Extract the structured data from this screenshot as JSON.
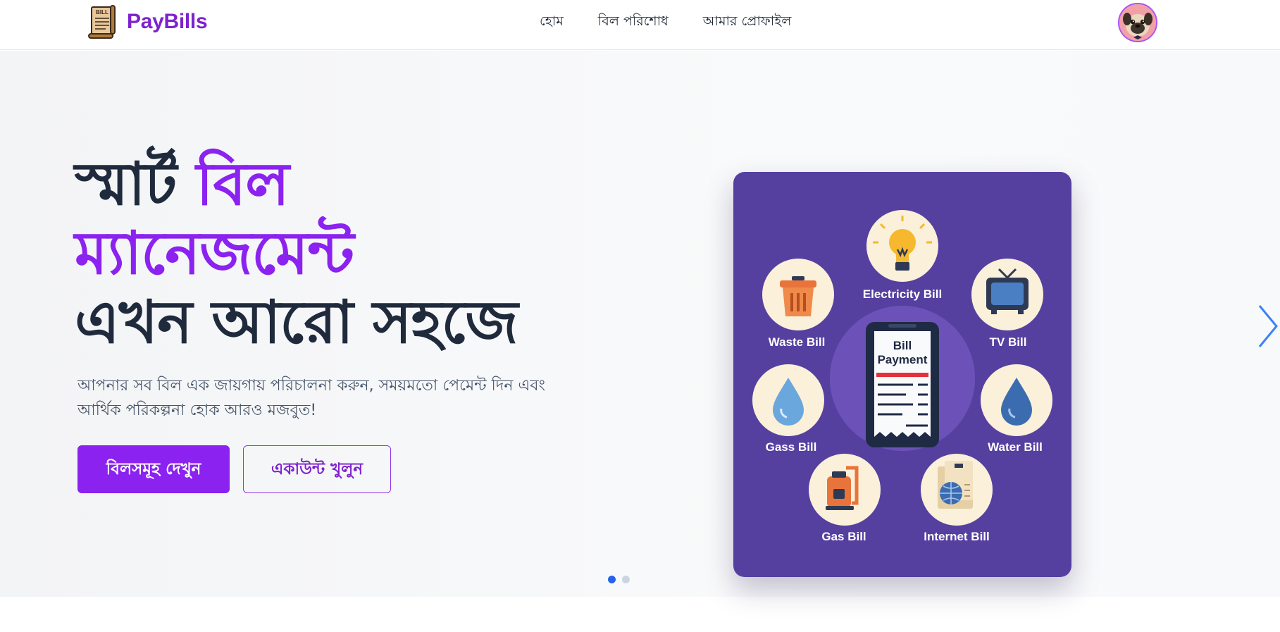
{
  "brand": {
    "name": "PayBills",
    "logo_icon": "bill-scroll-icon",
    "logo_text": "BILL"
  },
  "nav": {
    "links": [
      "হোম",
      "বিল পরিশোধ",
      "আমার প্রোফাইল"
    ]
  },
  "user": {
    "avatar_icon": "pug-avatar-icon"
  },
  "hero": {
    "headline_line1_a": "স্মার্ট",
    "headline_line1_b": "বিল",
    "headline_line2": "ম্যানেজমেন্ট",
    "headline_line3": "এখন আরো সহজে",
    "subtitle_line1": "আপনার সব বিল এক জায়গায় পরিচালনা করুন, সময়মতো পেমেন্ট দিন এবং",
    "subtitle_line2": "আর্থিক পরিকল্পনা হোক আরও মজবুত!",
    "primary_button": "বিলসমূহ দেখুন",
    "secondary_button": "একাউন্ট খুলুন"
  },
  "illustration": {
    "center_title_1": "Bill",
    "center_title_2": "Payment",
    "items": [
      {
        "label": "Electricity Bill",
        "icon": "lightbulb-icon"
      },
      {
        "label": "Waste Bill",
        "icon": "trash-bin-icon"
      },
      {
        "label": "TV Bill",
        "icon": "tv-icon"
      },
      {
        "label": "Gass  Bill",
        "icon": "water-drop-icon"
      },
      {
        "label": "Water Bill",
        "icon": "water-drop-icon"
      },
      {
        "label": "Gas Bill",
        "icon": "gas-cylinder-icon"
      },
      {
        "label": "Internet Bill",
        "icon": "globe-document-icon"
      }
    ]
  },
  "carousel": {
    "slide_count": 2,
    "active_slide": 1,
    "next_icon": "chevron-right-icon"
  },
  "colors": {
    "brand_purple": "#8b22f0",
    "headline_dark": "#1f2a3c",
    "card_bg": "#5540a0",
    "dot_active": "#2563eb",
    "arrow_blue": "#3b82f6"
  }
}
